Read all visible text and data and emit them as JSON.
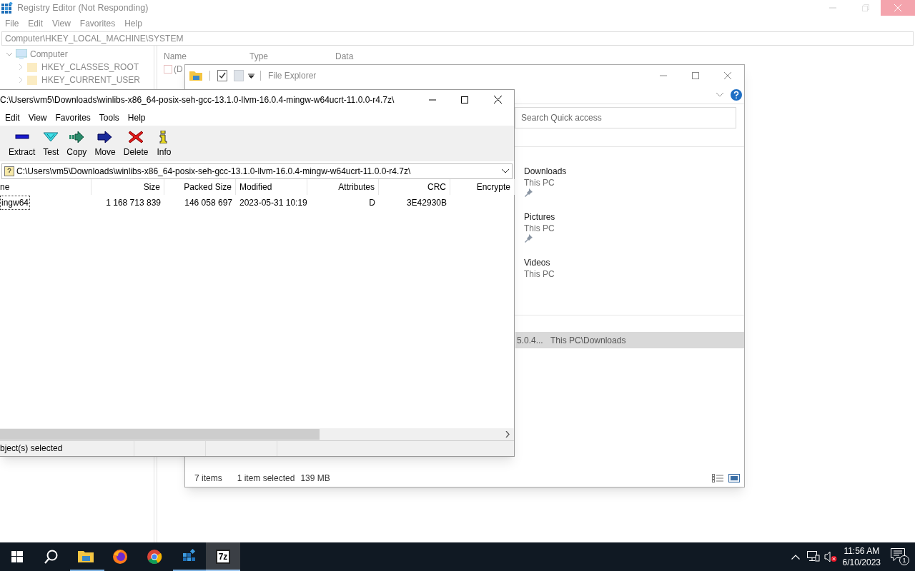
{
  "registry_editor": {
    "title": "Registry Editor (Not Responding)",
    "not_responding": true,
    "menu": [
      "File",
      "Edit",
      "View",
      "Favorites",
      "Help"
    ],
    "address": "Computer\\HKEY_LOCAL_MACHINE\\SYSTEM",
    "tree": [
      {
        "label": "Computer",
        "expanded": true,
        "children": [
          {
            "label": "HKEY_CLASSES_ROOT",
            "expanded": false
          },
          {
            "label": "HKEY_CURRENT_USER",
            "expanded": false
          }
        ]
      }
    ],
    "columns": [
      "Name",
      "Type",
      "Data"
    ],
    "values": [
      {
        "name": "(D"
      }
    ]
  },
  "file_explorer": {
    "title": "File Explorer",
    "search": {
      "placeholder": "Search Quick access"
    },
    "items": [
      {
        "name": "Downloads",
        "location": "This PC",
        "pinned": true
      },
      {
        "name": "Pictures",
        "location": "This PC",
        "pinned": true
      },
      {
        "name": "Videos",
        "location": "This PC",
        "pinned": false
      }
    ],
    "recent_row": {
      "column_1": "5.0.4...",
      "column_2": "This PC\\Downloads",
      "selected": true
    },
    "status": {
      "count": "7 items",
      "selection": "1 item selected",
      "size": "139 MB"
    }
  },
  "seven_zip": {
    "title": "C:\\Users\\vm5\\Downloads\\winlibs-x86_64-posix-seh-gcc-13.1.0-llvm-16.0.4-mingw-w64ucrt-11.0.0-r4.7z\\",
    "menu": [
      "Edit",
      "View",
      "Favorites",
      "Tools",
      "Help"
    ],
    "toolbar": [
      {
        "label": "Extract",
        "kind": "extract"
      },
      {
        "label": "Test",
        "kind": "test"
      },
      {
        "label": "Copy",
        "kind": "copy"
      },
      {
        "label": "Move",
        "kind": "move"
      },
      {
        "label": "Delete",
        "kind": "delete"
      },
      {
        "label": "Info",
        "kind": "info"
      }
    ],
    "path": "C:\\Users\\vm5\\Downloads\\winlibs-x86_64-posix-seh-gcc-13.1.0-llvm-16.0.4-mingw-w64ucrt-11.0.0-r4.7z\\",
    "columns": [
      {
        "label": "ne",
        "kind": "text"
      },
      {
        "label": "Size",
        "kind": "number"
      },
      {
        "label": "Packed Size",
        "kind": "number"
      },
      {
        "label": "Modified",
        "kind": "text"
      },
      {
        "label": "Attributes",
        "kind": "number"
      },
      {
        "label": "CRC",
        "kind": "number"
      },
      {
        "label": "Encrypte",
        "kind": "number"
      }
    ],
    "rows": [
      {
        "cells": [
          "ingw64",
          "1 168 713 839",
          "146 058 697",
          "2023-05-31 10:19",
          "D",
          "3E42930B"
        ],
        "selected": true
      }
    ],
    "status": "bject(s) selected"
  },
  "taskbar": {
    "apps": [
      {
        "kind": "start",
        "running": false,
        "active": false
      },
      {
        "kind": "search",
        "running": false,
        "active": false
      },
      {
        "kind": "explorer",
        "running": true,
        "active": false
      },
      {
        "kind": "firefox",
        "running": false,
        "active": false
      },
      {
        "kind": "chrome",
        "running": false,
        "active": false
      },
      {
        "kind": "regedit",
        "running": true,
        "active": false
      },
      {
        "kind": "sevenzip",
        "running": true,
        "active": true,
        "label": "7z"
      }
    ],
    "time": "11:56 AM",
    "date": "6/10/2023",
    "notifications": "1"
  }
}
